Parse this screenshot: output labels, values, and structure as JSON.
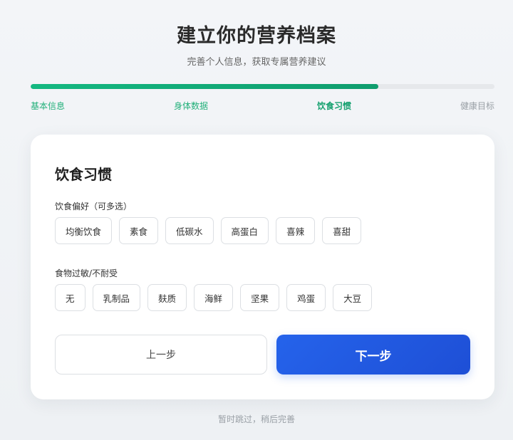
{
  "header": {
    "title": "建立你的营养档案",
    "subtitle": "完善个人信息，获取专属营养建议"
  },
  "progress": {
    "fraction": 0.75,
    "steps": [
      {
        "label": "基本信息",
        "state": "done"
      },
      {
        "label": "身体数据",
        "state": "done"
      },
      {
        "label": "饮食习惯",
        "state": "active"
      },
      {
        "label": "健康目标",
        "state": "pending"
      }
    ]
  },
  "card": {
    "title": "饮食习惯",
    "preferences": {
      "label": "饮食偏好（可多选）",
      "options": [
        "均衡饮食",
        "素食",
        "低碳水",
        "高蛋白",
        "喜辣",
        "喜甜"
      ]
    },
    "allergies": {
      "label": "食物过敏/不耐受",
      "options": [
        "无",
        "乳制品",
        "麸质",
        "海鲜",
        "坚果",
        "鸡蛋",
        "大豆"
      ]
    },
    "prev_label": "上一步",
    "next_label": "下一步"
  },
  "skip_label": "暂时跳过，稍后完善",
  "colors": {
    "accent_green": "#14b881",
    "primary_blue": "#2563eb"
  }
}
